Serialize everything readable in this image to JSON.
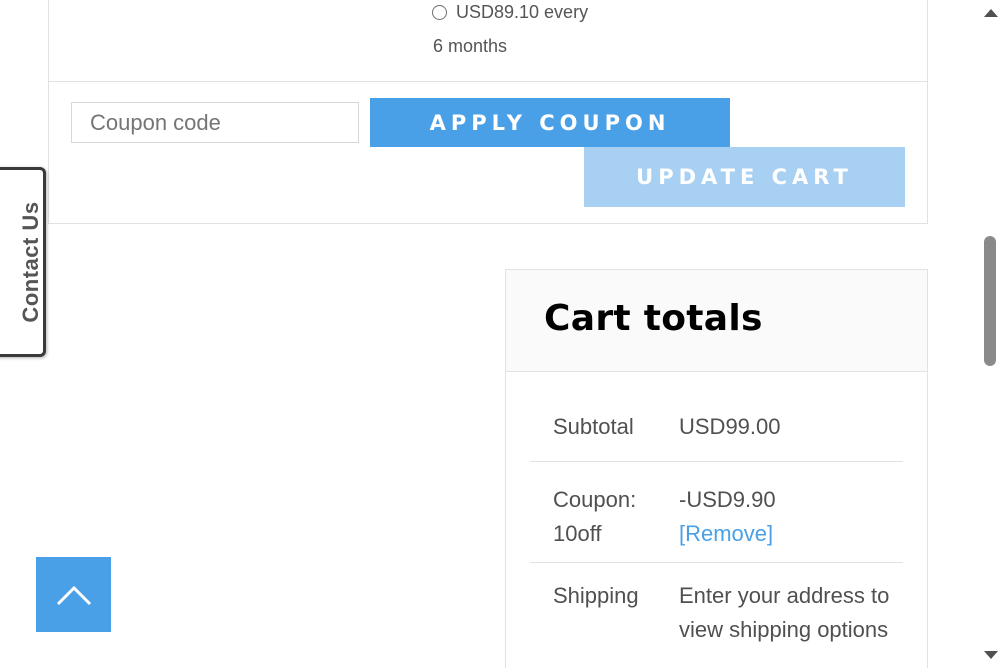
{
  "cart": {
    "subscription_option": {
      "line1": "USD89.10 every",
      "line2": "6 months"
    },
    "coupon_placeholder": "Coupon code",
    "apply_coupon_label": "APPLY COUPON",
    "update_cart_label": "UPDATE CART"
  },
  "totals": {
    "title": "Cart totals",
    "subtotal_label": "Subtotal",
    "subtotal_value": "USD99.00",
    "coupon_label_line1": "Coupon:",
    "coupon_label_line2": "10off",
    "coupon_value": "-USD9.90",
    "coupon_remove": "[Remove]",
    "shipping_label": "Shipping",
    "shipping_value": "Enter your address to view shipping options"
  },
  "contact_tab": {
    "label": "Contact Us"
  },
  "icons": {
    "back_to_top": "chevron-up-icon",
    "radio": "radio-icon"
  },
  "colors": {
    "accent": "#4aa0e6",
    "accent_light": "#a7d0f2",
    "text": "#505050"
  }
}
